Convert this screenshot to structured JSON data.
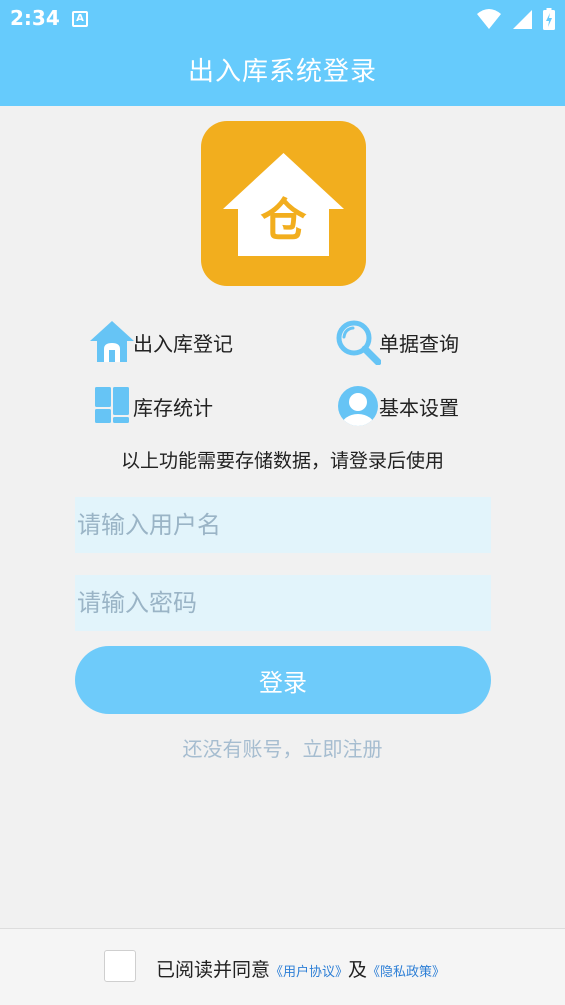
{
  "status": {
    "time": "2:34",
    "notification_badge": "A",
    "icons": [
      "wifi-icon",
      "signal-icon",
      "battery-icon"
    ]
  },
  "appbar": {
    "title": "出入库系统登录"
  },
  "logo": {
    "glyph": "仓",
    "color": "#f2ae1e"
  },
  "features": [
    {
      "label": "出入库登记",
      "icon": "house-icon"
    },
    {
      "label": "单据查询",
      "icon": "magnifier-icon"
    },
    {
      "label": "库存统计",
      "icon": "grid-blocks-icon"
    },
    {
      "label": "基本设置",
      "icon": "user-avatar-icon"
    }
  ],
  "notice": "以上功能需要存储数据，请登录后使用",
  "form": {
    "username": {
      "value": "",
      "placeholder": "请输入用户名"
    },
    "password": {
      "value": "",
      "placeholder": "请输入密码"
    },
    "login_label": "登录",
    "register_label": "还没有账号，立即注册"
  },
  "footer": {
    "checked": false,
    "prefix": "已阅读并同意",
    "user_agreement": "《用户协议》",
    "and": "及",
    "privacy_policy": "《隐私政策》"
  },
  "colors": {
    "primary": "#66cbfc",
    "logo": "#f2ae1e",
    "input_bg": "#e2f4fb",
    "link": "#2d7fd6",
    "icon_blue": "#66c4f5"
  }
}
